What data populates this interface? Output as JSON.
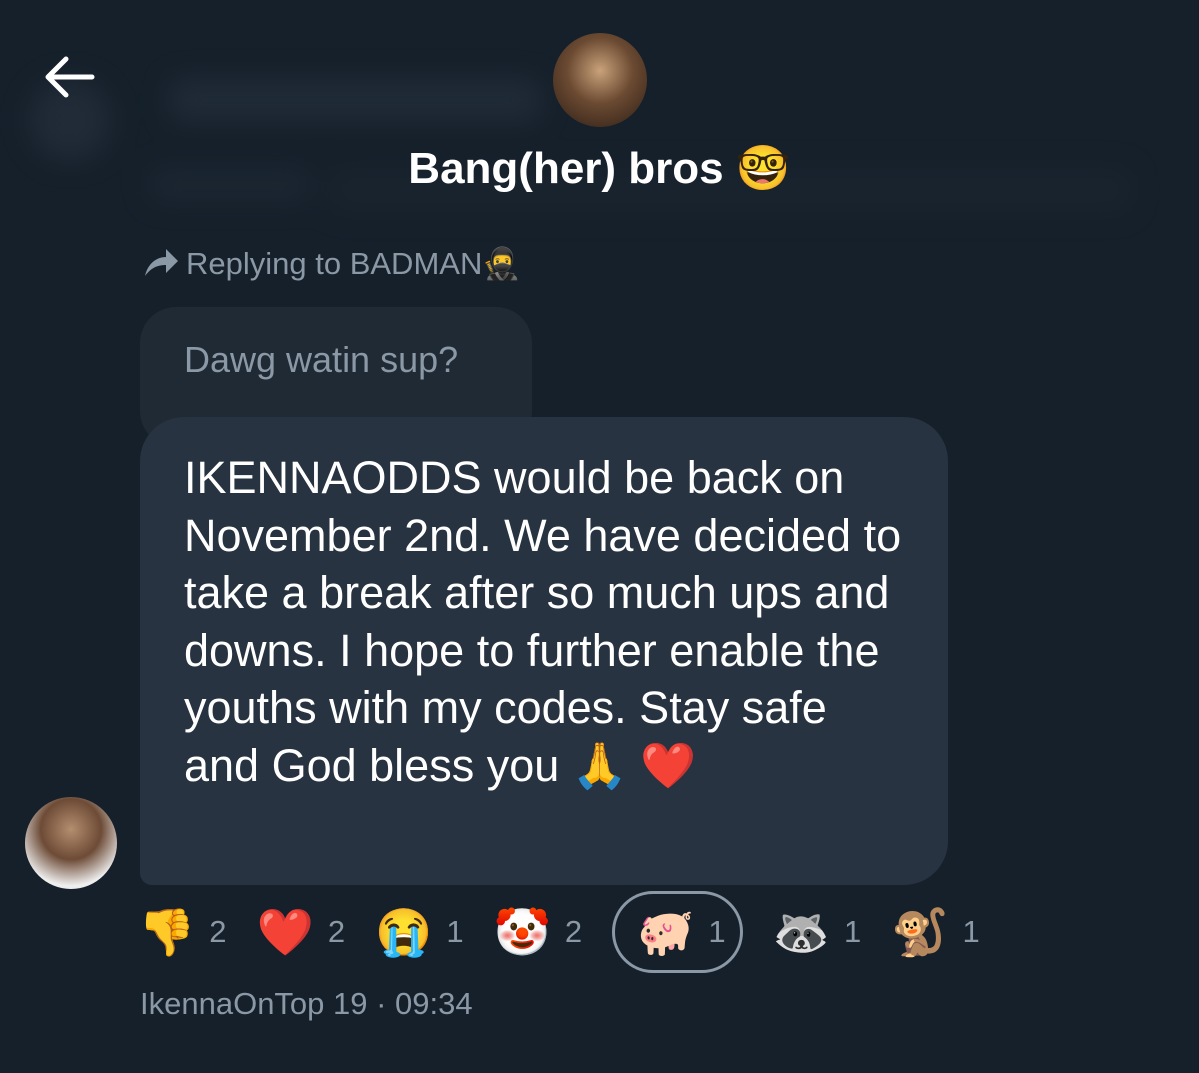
{
  "header": {
    "back_icon": "arrow-left-icon",
    "group_name": "Bang(her) bros",
    "group_emoji": "🤓"
  },
  "reply": {
    "icon": "reply-arrow-icon",
    "text": "Replying to BADMAN🥷"
  },
  "quoted_message": {
    "text": "Dawg watin sup?"
  },
  "message": {
    "text": "IKENNAODDS would be back on November 2nd. We have decided to take a break after so much ups and downs. I hope to further enable the youths with my codes. Stay safe  and God bless you 🙏 ❤️"
  },
  "reactions": [
    {
      "emoji": "👎",
      "count": "2",
      "selected": false
    },
    {
      "emoji": "❤️",
      "count": "2",
      "selected": false
    },
    {
      "emoji": "😭",
      "count": "1",
      "selected": false
    },
    {
      "emoji": "🤡",
      "count": "2",
      "selected": false
    },
    {
      "emoji": "🐖",
      "count": "1",
      "selected": true
    },
    {
      "emoji": "🦝",
      "count": "1",
      "selected": false
    },
    {
      "emoji": "🐒",
      "count": "1",
      "selected": false
    }
  ],
  "meta": {
    "text": "IkennaOnTop 19 · 09:34"
  },
  "colors": {
    "background": "#15202b",
    "bubble": "#273340",
    "quoted_bubble": "#1f2a35",
    "muted_text": "#8b98a5"
  }
}
